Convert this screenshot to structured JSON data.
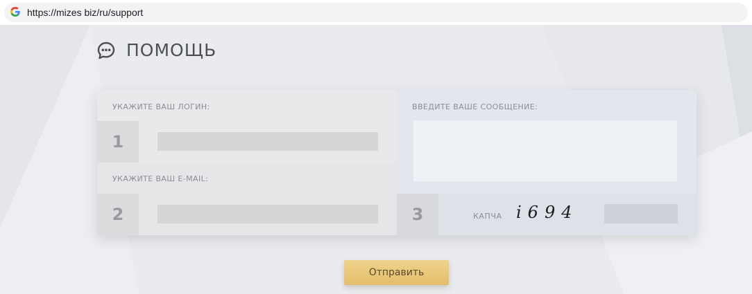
{
  "browser": {
    "url": "https://mizes biz/ru/support",
    "favicon": "google-g-icon"
  },
  "page": {
    "title": "ПОМОЩЬ",
    "title_icon": "chat-bubble-icon"
  },
  "form": {
    "login": {
      "label": "УКАЖИТЕ ВАШ ЛОГИН:",
      "step": "1",
      "value": ""
    },
    "email": {
      "label": "УКАЖИТЕ ВАШ E-MAIL:",
      "step": "2",
      "value": ""
    },
    "message": {
      "label": "ВВЕДИТЕ ВАШЕ СООБЩЕНИЕ:",
      "value": ""
    },
    "captcha": {
      "step": "3",
      "label": "КАПЧА",
      "code": "i694",
      "value": ""
    },
    "submit_label": "Отправить"
  },
  "colors": {
    "background": "#e9ebef",
    "button_gold": "#e9c77a",
    "text_dark": "#4d4f55",
    "label_gray": "#8c8d93"
  }
}
